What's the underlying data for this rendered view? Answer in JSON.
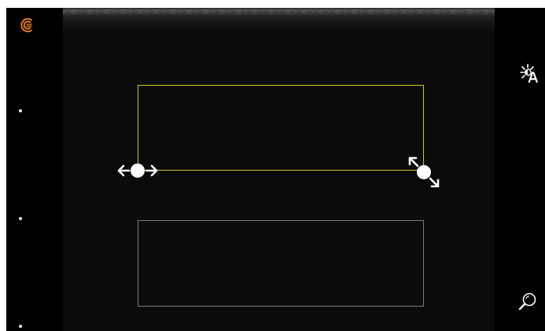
{
  "app": {
    "logo_icon": "ultrasound-logo-icon",
    "accent_color": "#e07a1c"
  },
  "regions": {
    "active_roi_color": "#d6c62a",
    "inactive_roi_color": "#7a7a7a"
  },
  "controls": {
    "move_handle_icon": "horizontal-move-handle-icon",
    "resize_handle_icon": "diagonal-resize-handle-icon",
    "auto_brightness_icon": "auto-brightness-icon",
    "zoom_icon": "magnifier-icon"
  },
  "depth_markers": {
    "count": 3,
    "color": "#e8e8e8"
  }
}
